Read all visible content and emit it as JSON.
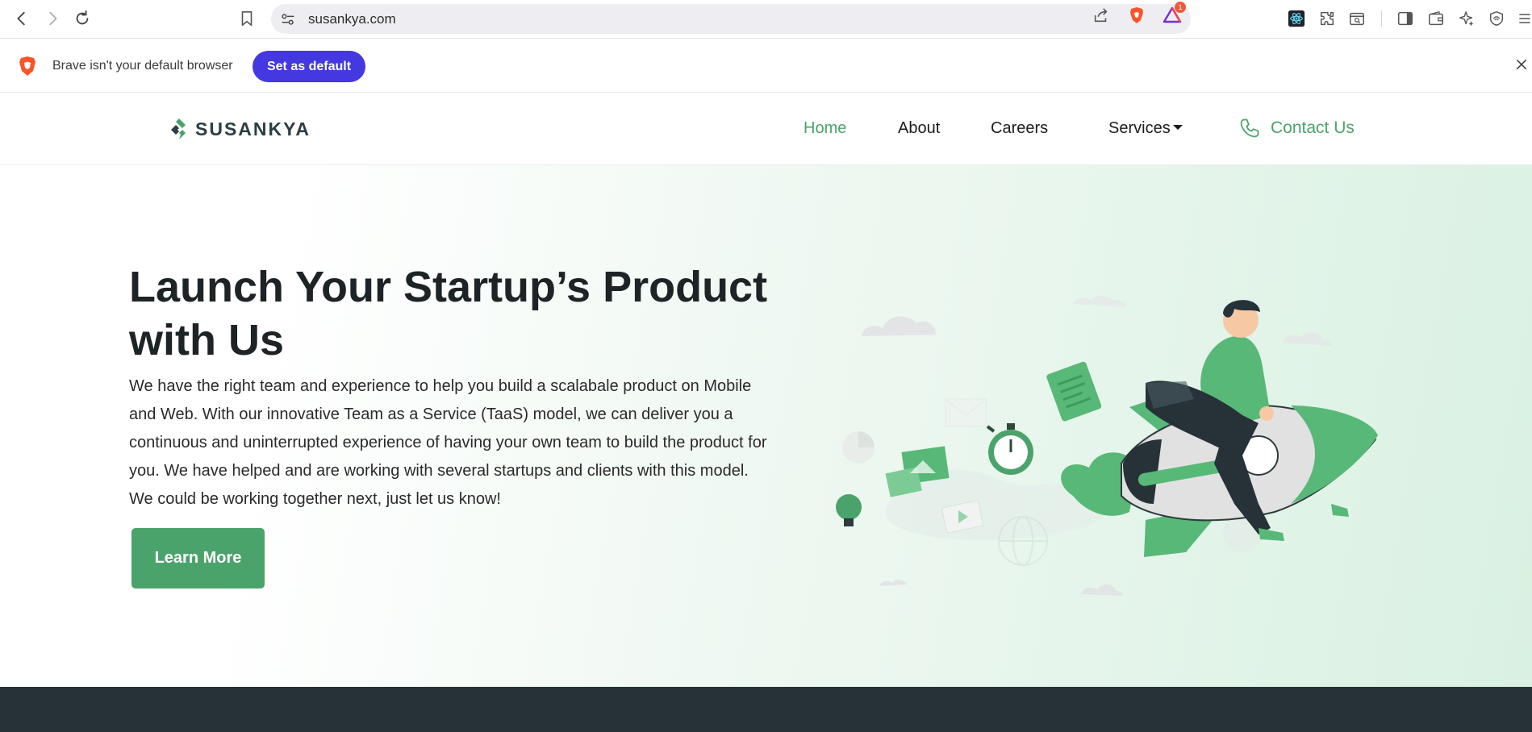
{
  "browser": {
    "url": "susankya.com",
    "shields_badge": "1",
    "icons": [
      "back-icon",
      "forward-icon",
      "reload-icon",
      "bookmark-icon",
      "site-settings-icon",
      "share-icon",
      "brave-shields-icon",
      "brave-rewards-icon",
      "react-devtools-icon",
      "extensions-icon",
      "tab-search-icon",
      "sidebar-icon",
      "wallet-icon",
      "leo-ai-icon",
      "vpn-icon",
      "menu-icon"
    ]
  },
  "infobar": {
    "message": "Brave isn't your default browser",
    "button": "Set as default"
  },
  "site": {
    "brand": "SUSANKYA",
    "nav": {
      "home": "Home",
      "about": "About",
      "careers": "Careers",
      "services": "Services",
      "contact": "Contact Us"
    },
    "accent_color": "#4aa36b"
  },
  "hero": {
    "title": "Launch Your Startup’s Product with Us",
    "body": "We have the right team and experience to help you build a scalabale product on Mobile and Web. With our innovative Team as a Service (TaaS) model, we can deliver you a continuous and uninterrupted experience of having your own team to build the product for you. We have helped and are working with several startups and clients with this model. We could be working together next, just let us know!",
    "cta": "Learn More"
  }
}
